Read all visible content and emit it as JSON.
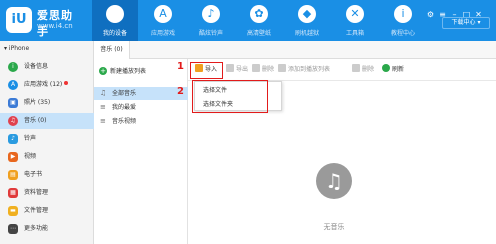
{
  "app": {
    "name": "爱思助手",
    "url": "www.i4.cn",
    "logo_mark": "iU"
  },
  "nav": [
    {
      "label": "我的设备",
      "icon": "apple-icon",
      "glyph": ""
    },
    {
      "label": "应用游戏",
      "icon": "appstore-icon",
      "glyph": "A"
    },
    {
      "label": "酷炫铃声",
      "icon": "bell-icon",
      "glyph": "♪"
    },
    {
      "label": "高清壁纸",
      "icon": "flower-icon",
      "glyph": "✿"
    },
    {
      "label": "刷机越狱",
      "icon": "cube-icon",
      "glyph": "◆"
    },
    {
      "label": "工具箱",
      "icon": "tools-icon",
      "glyph": "✕"
    },
    {
      "label": "教程中心",
      "icon": "info-icon",
      "glyph": "i"
    }
  ],
  "window": {
    "download_center": "下载中心 ▾"
  },
  "device": {
    "header": "▾ iPhone"
  },
  "sidebar": [
    {
      "label": "设备信息",
      "icon": "info-icon",
      "color": "#2aa84a",
      "glyph": "i"
    },
    {
      "label": "应用游戏 (12)",
      "icon": "appstore-icon",
      "color": "#1a8fe5",
      "glyph": "A"
    },
    {
      "label": "照片 (35)",
      "icon": "photo-icon",
      "color": "#3c7bd6",
      "glyph": "▣"
    },
    {
      "label": "音乐 (0)",
      "icon": "music-icon",
      "color": "#e0414e",
      "glyph": "♫"
    },
    {
      "label": "铃声",
      "icon": "bell-icon",
      "color": "#2a9be0",
      "glyph": "♪"
    },
    {
      "label": "视频",
      "icon": "video-icon",
      "color": "#e8671e",
      "glyph": "▶"
    },
    {
      "label": "电子书",
      "icon": "book-icon",
      "color": "#f0a020",
      "glyph": "▤"
    },
    {
      "label": "资料管理",
      "icon": "contacts-icon",
      "color": "#e03a3a",
      "glyph": "▦"
    },
    {
      "label": "文件管理",
      "icon": "folder-icon",
      "color": "#f0b020",
      "glyph": "▬"
    },
    {
      "label": "更多功能",
      "icon": "more-icon",
      "color": "#444444",
      "glyph": "⋯"
    }
  ],
  "tab": {
    "label": "音乐 (0)"
  },
  "midpanel": {
    "new_playlist": "新建播放列表",
    "items": [
      {
        "label": "全部音乐",
        "icon": "music-note-icon"
      },
      {
        "label": "我的最爱",
        "icon": "playlist-icon"
      },
      {
        "label": "音乐视频",
        "icon": "music-video-icon"
      }
    ]
  },
  "toolbar": {
    "import": "导入",
    "export": "导出",
    "delete": "删除",
    "add_to_playlist": "添加到播放列表",
    "remove": "删除",
    "refresh": "刷新"
  },
  "annotations": {
    "step1": "1",
    "step2": "2"
  },
  "dropdown": {
    "select_file": "选择文件",
    "select_folder": "选择文件夹"
  },
  "empty": {
    "text": "无音乐",
    "glyph": "♫"
  }
}
